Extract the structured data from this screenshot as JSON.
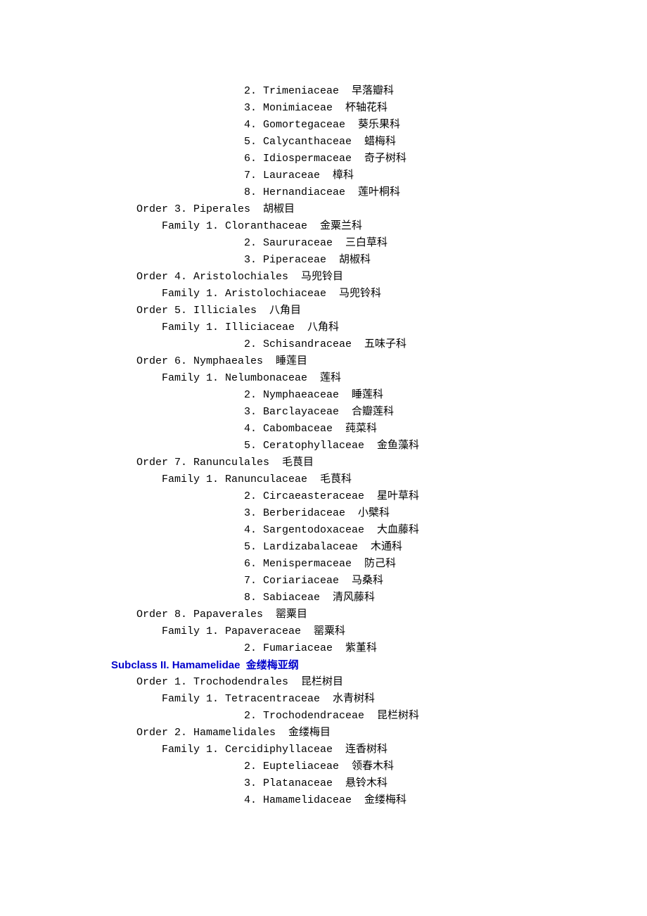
{
  "lines": [
    {
      "indent": 21,
      "text": "2. Trimeniaceae  早落瓣科"
    },
    {
      "indent": 21,
      "text": "3. Monimiaceae  杯轴花科"
    },
    {
      "indent": 21,
      "text": "4. Gomortegaceae  葵乐果科"
    },
    {
      "indent": 21,
      "text": "5. Calycanthaceae  蜡梅科"
    },
    {
      "indent": 21,
      "text": "6. Idiospermaceae  奇子树科"
    },
    {
      "indent": 21,
      "text": "7. Lauraceae  樟科"
    },
    {
      "indent": 21,
      "text": "8. Hernandiaceae  莲叶桐科"
    },
    {
      "indent": 4,
      "text": "Order 3. Piperales  胡椒目"
    },
    {
      "indent": 8,
      "text": "Family 1. Cloranthaceae  金粟兰科"
    },
    {
      "indent": 21,
      "text": "2. Saururaceae  三白草科"
    },
    {
      "indent": 21,
      "text": "3. Piperaceae  胡椒科"
    },
    {
      "indent": 4,
      "text": "Order 4. Aristolochiales  马兜铃目"
    },
    {
      "indent": 8,
      "text": "Family 1. Aristolochiaceae  马兜铃科"
    },
    {
      "indent": 4,
      "text": "Order 5. Illiciales  八角目"
    },
    {
      "indent": 8,
      "text": "Family 1. Illiciaceae  八角科"
    },
    {
      "indent": 21,
      "text": "2. Schisandraceae  五味子科"
    },
    {
      "indent": 4,
      "text": "Order 6. Nymphaeales  睡莲目"
    },
    {
      "indent": 8,
      "text": "Family 1. Nelumbonaceae  莲科"
    },
    {
      "indent": 21,
      "text": "2. Nymphaeaceae  睡莲科"
    },
    {
      "indent": 21,
      "text": "3. Barclayaceae  合瓣莲科"
    },
    {
      "indent": 21,
      "text": "4. Cabombaceae  莼菜科"
    },
    {
      "indent": 21,
      "text": "5. Ceratophyllaceae  金鱼藻科"
    },
    {
      "indent": 4,
      "text": "Order 7. Ranunculales  毛茛目"
    },
    {
      "indent": 8,
      "text": "Family 1. Ranunculaceae  毛茛科"
    },
    {
      "indent": 21,
      "text": "2. Circaeasteraceae  星叶草科"
    },
    {
      "indent": 21,
      "text": "3. Berberidaceae  小檗科"
    },
    {
      "indent": 21,
      "text": "4. Sargentodoxaceae  大血藤科"
    },
    {
      "indent": 21,
      "text": "5. Lardizabalaceae  木通科"
    },
    {
      "indent": 21,
      "text": "6. Menispermaceae  防己科"
    },
    {
      "indent": 21,
      "text": "7. Coriariaceae  马桑科"
    },
    {
      "indent": 21,
      "text": "8. Sabiaceae  清风藤科"
    },
    {
      "indent": 4,
      "text": "Order 8. Papaverales  罂粟目"
    },
    {
      "indent": 8,
      "text": "Family 1. Papaveraceae  罂粟科"
    },
    {
      "indent": 21,
      "text": "2. Fumariaceae  紫堇科"
    },
    {
      "indent": 0,
      "text": ""
    },
    {
      "indent": 0,
      "text": "Subclass II. Hamamelidae  金缕梅亚纲",
      "subclass": true
    },
    {
      "indent": 4,
      "text": "Order 1. Trochodendrales  昆栏树目"
    },
    {
      "indent": 8,
      "text": "Family 1. Tetracentraceae  水青树科"
    },
    {
      "indent": 21,
      "text": "2. Trochodendraceae  昆栏树科"
    },
    {
      "indent": 4,
      "text": "Order 2. Hamamelidales  金缕梅目"
    },
    {
      "indent": 8,
      "text": "Family 1. Cercidiphyllaceae  连香树科"
    },
    {
      "indent": 21,
      "text": "2. Eupteliaceae  领春木科"
    },
    {
      "indent": 21,
      "text": "3. Platanaceae  悬铃木科"
    },
    {
      "indent": 21,
      "text": "4. Hamamelidaceae  金缕梅科"
    }
  ]
}
